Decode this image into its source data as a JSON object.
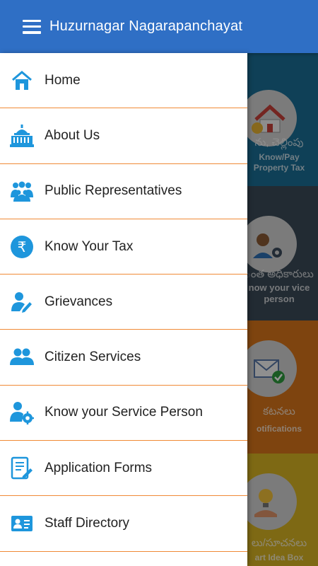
{
  "app_bar": {
    "title": "Huzurnagar Nagarapanchayat",
    "menu_icon": "hamburger-menu-icon",
    "color": "#2f6fc5"
  },
  "drawer": {
    "divider_color": "#f08a36",
    "icon_color": "#1e96dc",
    "items": [
      {
        "label": "Home",
        "icon": "home-icon"
      },
      {
        "label": "About Us",
        "icon": "government-building-icon"
      },
      {
        "label": "Public Representatives",
        "icon": "people-group-icon"
      },
      {
        "label": "Know Your Tax",
        "icon": "rupee-icon"
      },
      {
        "label": "Grievances",
        "icon": "user-edit-icon"
      },
      {
        "label": "Citizen Services",
        "icon": "users-icon"
      },
      {
        "label": "Know your Service Person",
        "icon": "user-settings-icon"
      },
      {
        "label": "Application Forms",
        "icon": "form-edit-icon"
      },
      {
        "label": "Staff Directory",
        "icon": "id-card-icon"
      }
    ]
  },
  "background_tiles": [
    {
      "line1": "ను, చెల్లింపు",
      "line2": "Know/Pay Property Tax",
      "color": "#1a6f97",
      "icon": "house-rupee-icon"
    },
    {
      "line1": "ంత అధికారులు",
      "line2": "now your vice person",
      "color": "#3c4a58",
      "icon": "person-gear-icon"
    },
    {
      "line1": "కటనలు",
      "line2": "otifications",
      "color": "#d9761a",
      "icon": "mail-check-icon"
    },
    {
      "line1": "లు/సూచనలు",
      "line2": "art Idea Box",
      "color": "#d9b524",
      "icon": "bulb-icon"
    }
  ]
}
